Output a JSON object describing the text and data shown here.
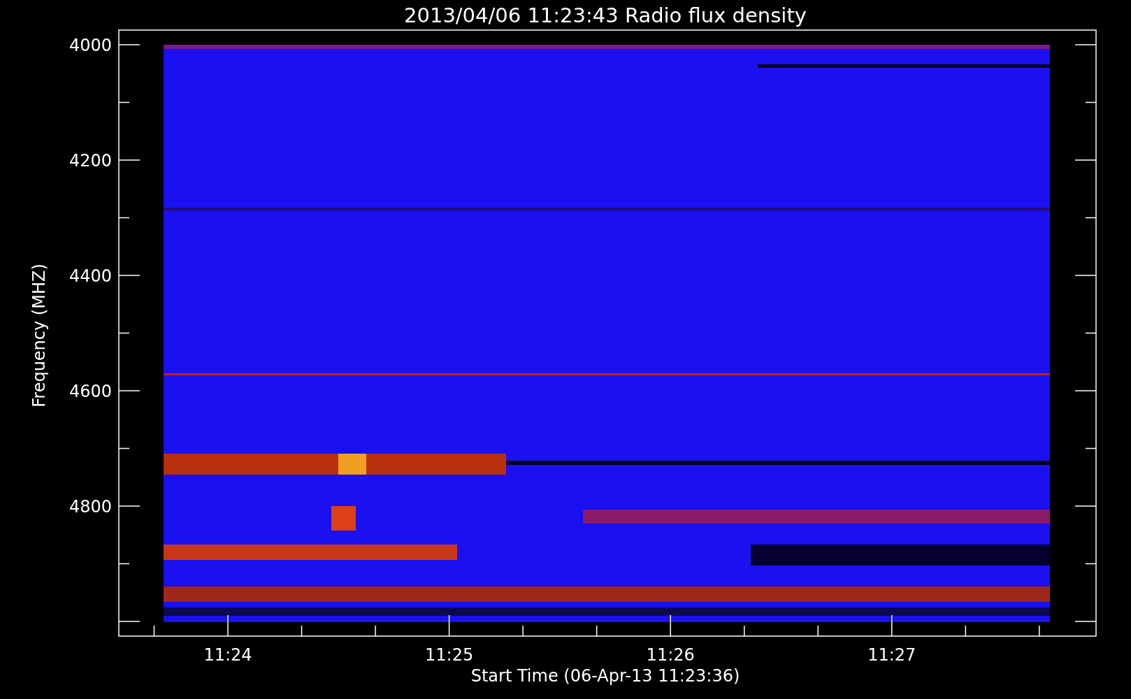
{
  "title": "2013/04/06 11:23:43 Radio flux density",
  "plot": {
    "ylabel": "Frequency (MHZ)",
    "xlabel": "Start Time (06-Apr-13 11:23:36)",
    "yticks": [
      "4000",
      "4200",
      "4400",
      "4600",
      "4800"
    ],
    "xticks": [
      "11:24",
      "11:25",
      "11:26",
      "11:27"
    ]
  }
}
